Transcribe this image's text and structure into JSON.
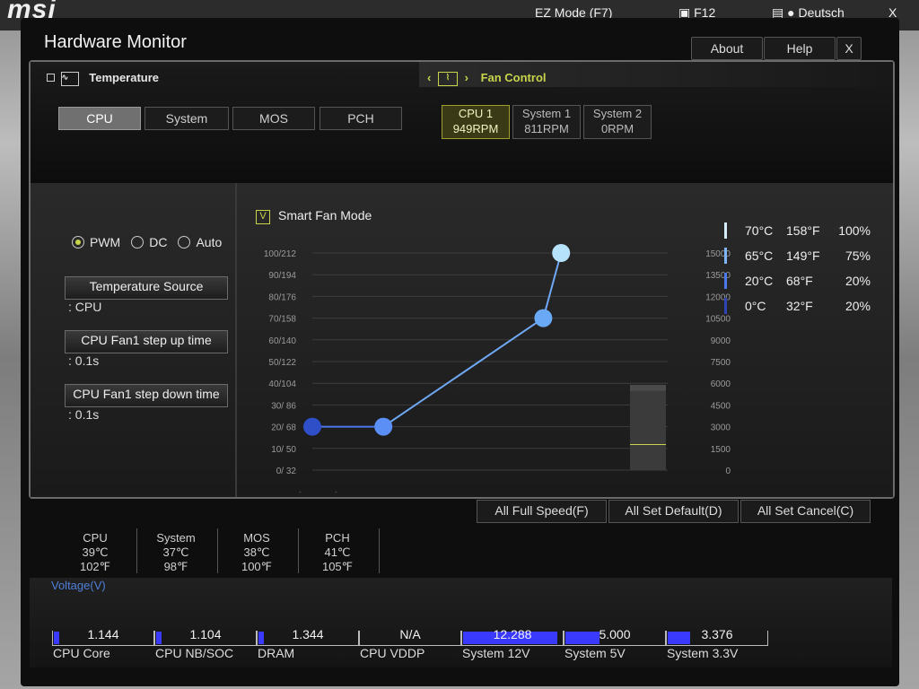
{
  "background": {
    "brand": "msi",
    "ez_mode": "EZ Mode (F7)",
    "f12": "F12",
    "language": "Deutsch",
    "close": "X"
  },
  "window": {
    "title": "Hardware Monitor",
    "about": "About",
    "help": "Help",
    "close": "X"
  },
  "temperature": {
    "title": "Temperature",
    "tabs": [
      "CPU",
      "System",
      "MOS",
      "PCH"
    ],
    "active_tab": "CPU"
  },
  "fan_control": {
    "title": "Fan Control",
    "tabs": [
      {
        "name": "CPU 1",
        "rpm": "949RPM"
      },
      {
        "name": "System 1",
        "rpm": "811RPM"
      },
      {
        "name": "System 2",
        "rpm": "0RPM"
      }
    ]
  },
  "mode": {
    "options": [
      "PWM",
      "DC",
      "Auto"
    ],
    "selected": "PWM"
  },
  "settings": {
    "temp_source_label": "Temperature Source",
    "temp_source_value": ": CPU",
    "step_up_label": "CPU Fan1 step up time",
    "step_up_value": ": 0.1s",
    "step_down_label": "CPU Fan1 step down time",
    "step_down_value": ": 0.1s"
  },
  "smart_fan": {
    "label": "Smart Fan Mode",
    "checked": true,
    "check_mark": "V"
  },
  "chart_data": {
    "type": "line",
    "left_ticks": [
      "100/212",
      "90/194",
      "80/176",
      "70/158",
      "60/140",
      "50/122",
      "40/104",
      "30/ 86",
      "20/ 68",
      "10/ 50",
      "0/ 32"
    ],
    "right_ticks": [
      "15000",
      "13500",
      "12000",
      "10500",
      "9000",
      "7500",
      "6000",
      "4500",
      "3000",
      "1500",
      "0"
    ],
    "left_unit_c": "(℃)",
    "left_unit_f": "(℉)",
    "right_unit": "(RPM)",
    "x": [
      0,
      20,
      65,
      70
    ],
    "y": [
      20,
      20,
      70,
      100
    ],
    "ylim": [
      0,
      100
    ],
    "grid": true,
    "point_colors": [
      "#2f4fc9",
      "#5b8ff5",
      "#6aa9f5",
      "#b7e2fb"
    ],
    "line_color": "#6fa8f5",
    "current_rpm": 949,
    "gauge_level": 0.3
  },
  "legend": [
    {
      "c": "70°C",
      "f": "158°F",
      "pct": "100%",
      "color": "#d5ecfb"
    },
    {
      "c": "65°C",
      "f": "149°F",
      "pct": "75%",
      "color": "#7fb4f6"
    },
    {
      "c": "20°C",
      "f": "68°F",
      "pct": "20%",
      "color": "#4d79ec"
    },
    {
      "c": "0°C",
      "f": "32°F",
      "pct": "20%",
      "color": "#2d44b5"
    }
  ],
  "actions": {
    "full_speed": "All Full Speed(F)",
    "set_default": "All Set Default(D)",
    "set_cancel": "All Set Cancel(C)"
  },
  "temp_summary": [
    {
      "name": "CPU",
      "c": "39℃",
      "f": "102℉"
    },
    {
      "name": "System",
      "c": "37℃",
      "f": "98℉"
    },
    {
      "name": "MOS",
      "c": "38℃",
      "f": "100℉"
    },
    {
      "name": "PCH",
      "c": "41℃",
      "f": "105℉"
    }
  ],
  "voltage": {
    "title": "Voltage(V)",
    "items": [
      {
        "label": "CPU Core",
        "value": "1.144",
        "fill": 0.06
      },
      {
        "label": "CPU NB/SOC",
        "value": "1.104",
        "fill": 0.06
      },
      {
        "label": "DRAM",
        "value": "1.344",
        "fill": 0.07
      },
      {
        "label": "CPU VDDP",
        "value": "N/A",
        "fill": 0
      },
      {
        "label": "System 12V",
        "value": "12.288",
        "fill": 0.97
      },
      {
        "label": "System 5V",
        "value": "5.000",
        "fill": 0.35
      },
      {
        "label": "System 3.3V",
        "value": "3.376",
        "fill": 0.23
      }
    ]
  }
}
